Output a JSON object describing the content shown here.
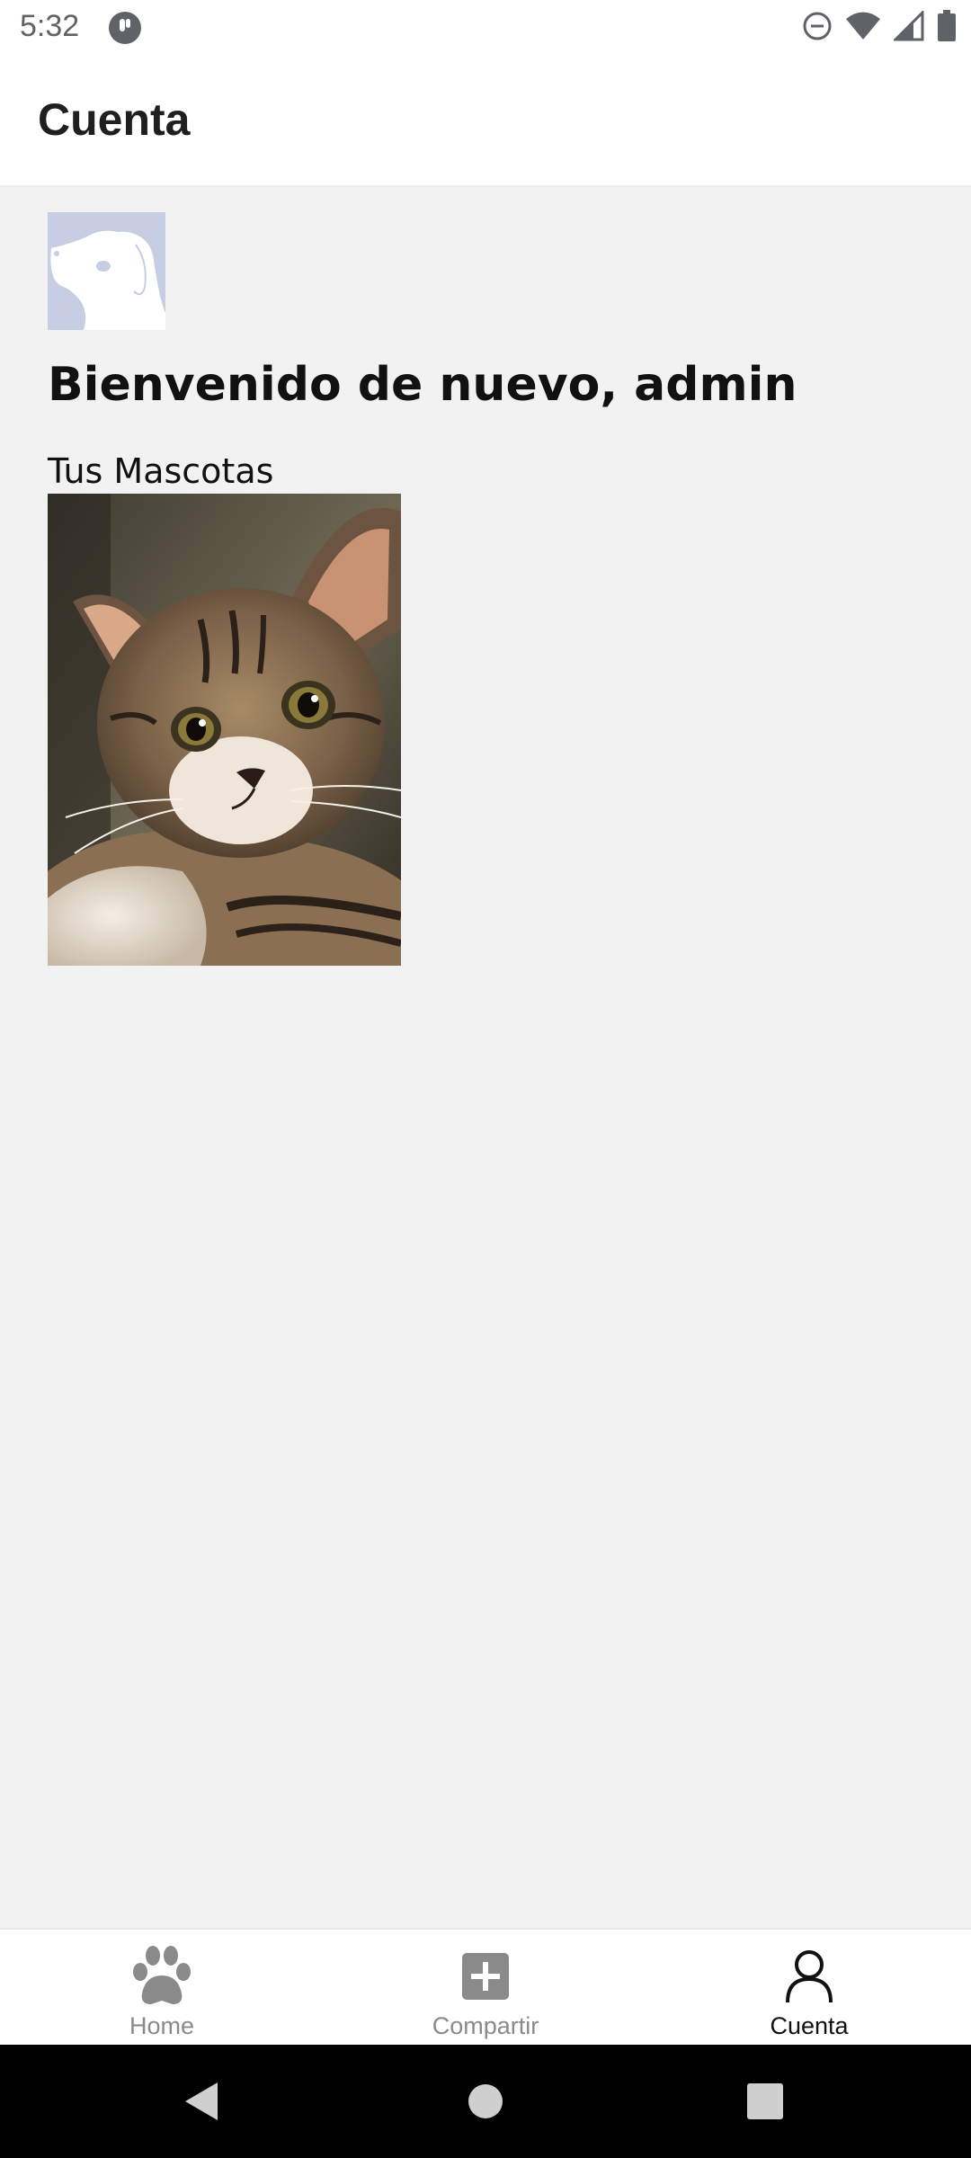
{
  "status_bar": {
    "time": "5:32",
    "icons": [
      "app-notification-icon",
      "do-not-disturb-icon",
      "wifi-icon",
      "cell-signal-icon",
      "battery-icon"
    ]
  },
  "app_bar": {
    "title": "Cuenta"
  },
  "account": {
    "avatar_icon": "dog-placeholder-avatar",
    "welcome_text": "Bienvenido de nuevo, admin",
    "pets_heading": "Tus Mascotas",
    "pets": [
      {
        "image": "tabby-kitten-photo"
      }
    ]
  },
  "bottom_nav": {
    "items": [
      {
        "label": "Home",
        "icon": "paw-icon",
        "active": false
      },
      {
        "label": "Compartir",
        "icon": "add-box-icon",
        "active": false
      },
      {
        "label": "Cuenta",
        "icon": "person-icon",
        "active": true
      }
    ]
  },
  "system_nav": {
    "buttons": [
      "back-button",
      "home-button",
      "recents-button"
    ]
  },
  "colors": {
    "background": "#f2f2f2",
    "surface": "#ffffff",
    "avatar_bg": "#c7cde3",
    "inactive": "#8a8a8a",
    "active": "#111111"
  }
}
